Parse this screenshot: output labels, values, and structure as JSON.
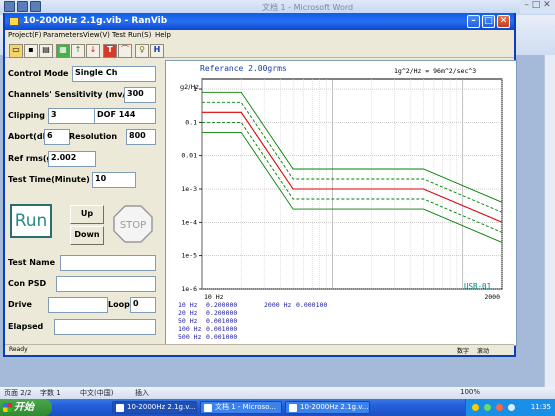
{
  "word": {
    "title": "文档 1 - Microsoft Word",
    "status": {
      "page": "页面 2/2",
      "words": "字数 1",
      "language": "中文(中国)",
      "insert": "插入",
      "zoom": "100%"
    }
  },
  "taskbar": {
    "start": "开始",
    "tasks": [
      "10-2000Hz 2.1g.v...",
      "文档 1 - Microso...",
      "10-2000Hz 2.1g.v..."
    ],
    "clock": "11:35"
  },
  "app": {
    "title": "10-2000Hz 2.1g.vib - RanVib",
    "menus": [
      "Project(F)",
      "Parameters",
      "View(V)",
      "Test Run(S)",
      "Help"
    ],
    "labels": {
      "control_mode": "Control Mode",
      "sensitivity": "Channels' Sensitivity (mv/g)",
      "clipping": "Clipping",
      "abort": "Abort(dB)",
      "resolution": "Resolution",
      "ref_rms": "Ref rms(g)",
      "test_time": "Test Time(Minute)",
      "test_name": "Test Name",
      "con_psd": "Con PSD",
      "drive": "Drive",
      "loop": "Loop",
      "elapsed": "Elapsed"
    },
    "values": {
      "control_mode": "Single Ch",
      "sensitivity": "300",
      "clipping": "3",
      "dof": "DOF 144",
      "abort": "6",
      "resolution": "800",
      "ref_rms": "2.002",
      "test_time": "10",
      "test_name": "",
      "con_psd": "",
      "drive": "",
      "loop": "0",
      "elapsed": ""
    },
    "buttons": {
      "run": "Run",
      "up": "Up",
      "down": "Down",
      "stop": "STOP"
    },
    "statusbar": {
      "ready": "Ready",
      "num": "数字",
      "scroll": "滚动"
    }
  },
  "chart_data": {
    "type": "line",
    "title": "Referance   2.00grms",
    "annotation": "1g^2/Hz = 96m^2/sec^3",
    "ylabel": "g2/Hz",
    "corner_label": "USB-01",
    "x_tick_labels": [
      "10 Hz",
      "2000"
    ],
    "y_tick_labels": [
      "1",
      "0.1",
      "0.01",
      "1e-3",
      "1e-4",
      "1e-5",
      "1e-6"
    ],
    "xscale": "log",
    "yscale": "log",
    "xlim": [
      10,
      2000
    ],
    "ylim": [
      1e-06,
      2
    ],
    "grid": true,
    "profile_rows": [
      {
        "freq": "10 Hz",
        "psd": "0.200000"
      },
      {
        "freq": "20 Hz",
        "psd": "0.200000"
      },
      {
        "freq": "50 Hz",
        "psd": "0.001000"
      },
      {
        "freq": "100 Hz",
        "psd": "0.001000"
      },
      {
        "freq": "500 Hz",
        "psd": "0.001000"
      },
      {
        "freq": "2000 Hz",
        "psd": "0.000100"
      }
    ],
    "series": [
      {
        "color": "#e00000",
        "dash": false,
        "x": [
          10,
          20,
          50,
          500,
          2000
        ],
        "y": [
          0.2,
          0.2,
          0.001,
          0.001,
          0.0001
        ]
      },
      {
        "color": "#008000",
        "dash": true,
        "x": [
          10,
          20,
          50,
          500,
          2000
        ],
        "y": [
          0.4,
          0.4,
          0.002,
          0.002,
          0.0002
        ]
      },
      {
        "color": "#008000",
        "dash": true,
        "x": [
          10,
          20,
          50,
          500,
          2000
        ],
        "y": [
          0.1,
          0.1,
          0.0005,
          0.0005,
          5e-05
        ]
      },
      {
        "color": "#008000",
        "dash": false,
        "x": [
          10,
          20,
          50,
          500,
          2000
        ],
        "y": [
          0.8,
          0.8,
          0.004,
          0.004,
          0.0004
        ]
      },
      {
        "color": "#008000",
        "dash": false,
        "x": [
          10,
          20,
          50,
          500,
          2000
        ],
        "y": [
          0.05,
          0.05,
          0.00025,
          0.00025,
          2.5e-05
        ]
      }
    ]
  }
}
